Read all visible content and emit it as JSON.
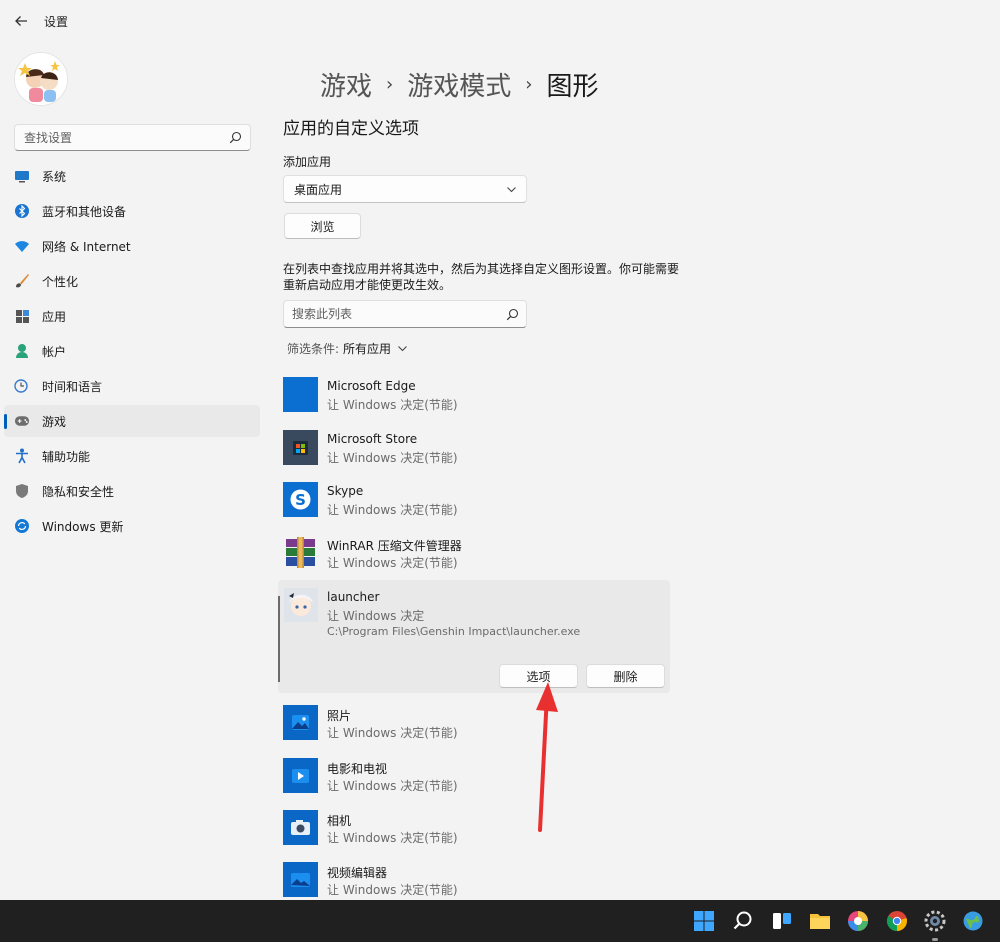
{
  "window": {
    "title": "设置"
  },
  "sidebar": {
    "search_placeholder": "查找设置",
    "items": [
      {
        "label": "系统",
        "icon": "monitor-icon",
        "active": false
      },
      {
        "label": "蓝牙和其他设备",
        "icon": "bluetooth-icon",
        "active": false
      },
      {
        "label": "网络 & Internet",
        "icon": "wifi-icon",
        "active": false
      },
      {
        "label": "个性化",
        "icon": "brush-icon",
        "active": false
      },
      {
        "label": "应用",
        "icon": "apps-icon",
        "active": false
      },
      {
        "label": "帐户",
        "icon": "person-icon",
        "active": false
      },
      {
        "label": "时间和语言",
        "icon": "globe-clock-icon",
        "active": false
      },
      {
        "label": "游戏",
        "icon": "gamepad-icon",
        "active": true
      },
      {
        "label": "辅助功能",
        "icon": "accessibility-icon",
        "active": false
      },
      {
        "label": "隐私和安全性",
        "icon": "shield-icon",
        "active": false
      },
      {
        "label": "Windows 更新",
        "icon": "update-icon",
        "active": false
      }
    ]
  },
  "breadcrumb": {
    "items": [
      "游戏",
      "游戏模式",
      "图形"
    ],
    "separator": "›"
  },
  "main": {
    "section_title": "应用的自定义选项",
    "add_app_label": "添加应用",
    "app_type_selected": "桌面应用",
    "browse_label": "浏览",
    "description": "在列表中查找应用并将其选中，然后为其选择自定义图形设置。你可能需要重新启动应用才能使更改生效。",
    "list_search_placeholder": "搜索此列表",
    "filter_label": "筛选条件:",
    "filter_value": "所有应用"
  },
  "apps": [
    {
      "name": "Microsoft Edge",
      "setting": "让 Windows 决定(节能)",
      "icon": "edge-icon"
    },
    {
      "name": "Microsoft Store",
      "setting": "让 Windows 决定(节能)",
      "icon": "store-icon"
    },
    {
      "name": "Skype",
      "setting": "让 Windows 决定(节能)",
      "icon": "skype-icon"
    },
    {
      "name": "WinRAR 压缩文件管理器",
      "setting": "让 Windows 决定(节能)",
      "icon": "winrar-icon"
    }
  ],
  "expanded_app": {
    "name": "launcher",
    "setting": "让 Windows 决定",
    "path": "C:\\Program Files\\Genshin Impact\\launcher.exe",
    "options_label": "选项",
    "delete_label": "删除"
  },
  "apps_after": [
    {
      "name": "照片",
      "setting": "让 Windows 决定(节能)",
      "icon": "photos-icon"
    },
    {
      "name": "电影和电视",
      "setting": "让 Windows 决定(节能)",
      "icon": "movies-icon"
    },
    {
      "name": "相机",
      "setting": "让 Windows 决定(节能)",
      "icon": "camera-icon"
    },
    {
      "name": "视频编辑器",
      "setting": "让 Windows 决定(节能)",
      "icon": "video-editor-icon"
    }
  ],
  "taskbar": {
    "icons": [
      "start-icon",
      "search-icon",
      "task-view-icon",
      "file-explorer-icon",
      "color-app-icon",
      "chrome-icon",
      "settings-icon",
      "network-app-icon"
    ]
  },
  "colors": {
    "accent": "#005fb8",
    "app_tile_blue": "#0a67c5",
    "annotation_arrow": "#e83030"
  }
}
